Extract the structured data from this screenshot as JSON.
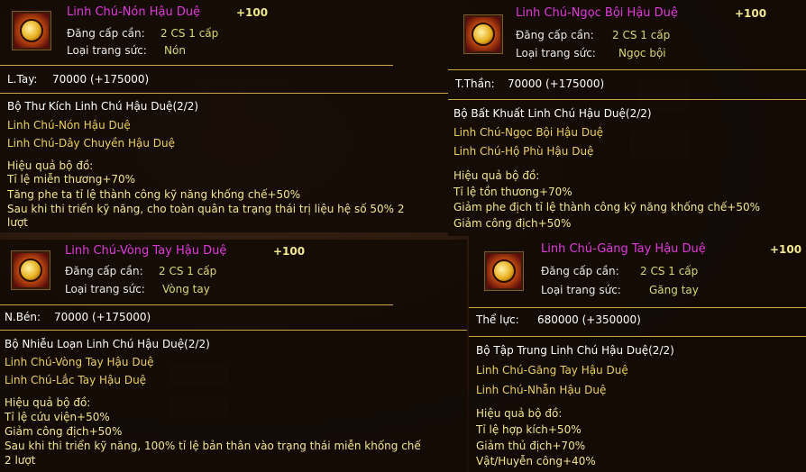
{
  "tooltips": [
    {
      "name": "Linh Chú-Nón Hậu Duệ",
      "bonus": "+100",
      "req_label": "Đăng cấp cần:",
      "req_value": "2 CS 1 cấp",
      "type_label": "Loại trang sức:",
      "type_value": "Nón",
      "stat_label": "L.Tay:",
      "stat_value": "70000 (+175000)",
      "set_name": "Bộ Thư Kích Linh Chú Hậu Duệ(2/2)",
      "members": [
        "Linh Chú-Nón Hậu Duệ",
        "Linh Chú-Dây Chuyền Hậu Duệ"
      ],
      "effect_header": "Hiệu quả bộ đồ:",
      "effects": [
        "Tỉ lệ miễn thương+70%",
        "Tăng phe ta tỉ lệ thành công kỹ năng khống chế+50%",
        "Sau khi thi triển kỹ năng, cho toàn quân ta trạng thái trị liệu hệ số 50% 2",
        "lượt"
      ]
    },
    {
      "name": "Linh Chú-Ngọc Bội Hậu Duệ",
      "bonus": "+100",
      "req_label": "Đăng cấp cần:",
      "req_value": "2 CS 1 cấp",
      "type_label": "Loại trang sức:",
      "type_value": "Ngọc bội",
      "stat_label": "T.Thần:",
      "stat_value": "70000 (+175000)",
      "set_name": "Bộ Bất Khuất Linh Chú Hậu Duệ(2/2)",
      "members": [
        "Linh Chú-Ngọc Bội Hậu Duệ",
        "Linh Chú-Hộ Phù Hậu Duệ"
      ],
      "effect_header": "Hiệu quả bộ đồ:",
      "effects": [
        "Tỉ lệ tồn thương+70%",
        "Giảm phe địch tỉ lệ thành công kỹ năng khống chế+50%",
        "Giảm công địch+50%"
      ]
    },
    {
      "name": "Linh Chú-Vòng Tay Hậu Duệ",
      "bonus": "+100",
      "req_label": "Đăng cấp cần:",
      "req_value": "2 CS 1 cấp",
      "type_label": "Loại trang sức:",
      "type_value": "Vòng tay",
      "stat_label": "N.Bén:",
      "stat_value": "70000 (+175000)",
      "set_name": "Bộ Nhiễu Loạn Linh Chú Hậu Duệ(2/2)",
      "members": [
        "Linh Chú-Vòng Tay Hậu Duệ",
        "Linh Chú-Lắc Tay Hậu Duệ"
      ],
      "effect_header": "Hiệu quả bộ đồ:",
      "effects": [
        "Tỉ lệ cứu viện+50%",
        "Giảm công địch+50%",
        "Sau khi thi triển kỹ năng, 100% tỉ lệ bản thân vào trạng thái miễn khống chế",
        "2 lượt"
      ]
    },
    {
      "name": "Linh Chú-Găng Tay Hậu Duệ",
      "bonus": "+100",
      "req_label": "Đăng cấp cần:",
      "req_value": "2 CS 1 cấp",
      "type_label": "Loại trang sức:",
      "type_value": "Găng tay",
      "stat_label": "Thể lực:",
      "stat_value": "680000 (+350000)",
      "set_name": "Bộ Tập Trung Linh Chú Hậu Duệ(2/2)",
      "members": [
        "Linh Chú-Găng Tay Hậu Duệ",
        "Linh Chú-Nhẫn Hậu Duệ"
      ],
      "effect_header": "Hiệu quả bộ đồ:",
      "effects": [
        "Tỉ lệ hợp kích+50%",
        "Giảm thủ địch+70%",
        "Vật/Huyễn công+40%"
      ]
    }
  ],
  "colors": {
    "title": "#e03adc",
    "bonus": "#f0e68c",
    "member": "#e8d060",
    "effect": "#f0e68c",
    "separator": "#c9a74a"
  },
  "icons": [
    "helmet-jewel-icon",
    "jade-pendant-icon",
    "bracelet-icon",
    "glove-icon"
  ]
}
